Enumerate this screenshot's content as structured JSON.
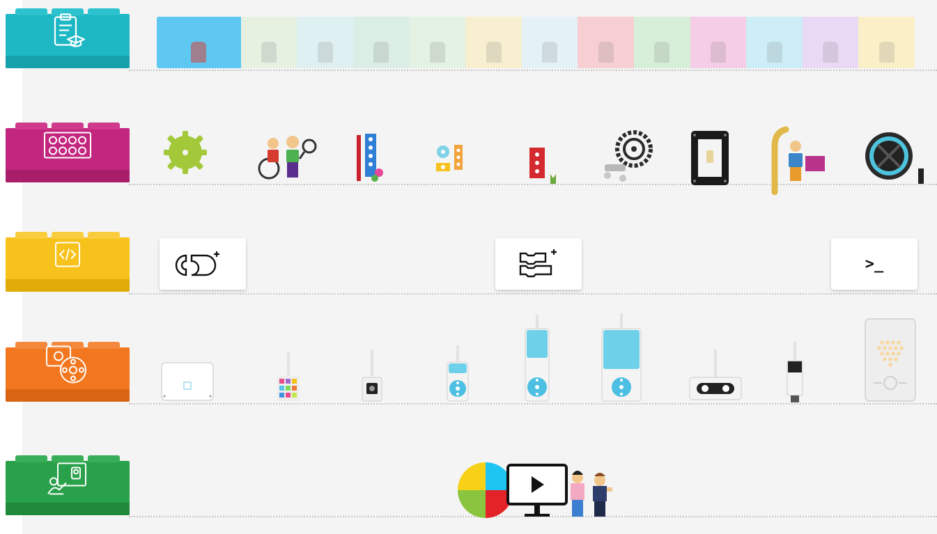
{
  "rows": [
    {
      "name": "lessons",
      "color": "#1eb7c4",
      "shade": "#16a0ac",
      "icon": "clipboard-graduation-icon"
    },
    {
      "name": "building-elements",
      "color": "#c3267e",
      "shade": "#a81e6b",
      "icon": "brick-studs-icon"
    },
    {
      "name": "coding",
      "color": "#f7c21b",
      "shade": "#e0aa08",
      "icon": "code-brackets-icon"
    },
    {
      "name": "hardware",
      "color": "#f2771f",
      "shade": "#d96414",
      "icon": "hub-motor-icon"
    },
    {
      "name": "teacher-support",
      "color": "#29a04a",
      "shade": "#1f8a3c",
      "icon": "teacher-board-icon"
    }
  ],
  "lesson_thumbnails": [
    {
      "color": "#5ec8f2"
    },
    {
      "color": "#e6f1e2"
    },
    {
      "color": "#dff0f3"
    },
    {
      "color": "#dbeee6"
    },
    {
      "color": "#e3f2e3"
    },
    {
      "color": "#f7efcf"
    },
    {
      "color": "#e4f2f7"
    },
    {
      "color": "#f7cfd2"
    },
    {
      "color": "#d7efd8"
    },
    {
      "color": "#f6cde6"
    },
    {
      "color": "#cdeef7"
    },
    {
      "color": "#ead9f4"
    },
    {
      "color": "#fbefc7"
    }
  ],
  "code_cards": [
    {
      "name": "word-blocks-card",
      "icon": "word-blocks-icon"
    },
    {
      "name": "icon-blocks-card",
      "icon": "icon-blocks-icon"
    },
    {
      "name": "python-card",
      "icon": "terminal-prompt-icon",
      "label": ">_"
    }
  ],
  "teacher_support": {
    "icon": "video-tutorial-icon",
    "pie_colors": [
      "#f7d117",
      "#1ec4f2",
      "#e42329",
      "#8bc53f"
    ]
  }
}
